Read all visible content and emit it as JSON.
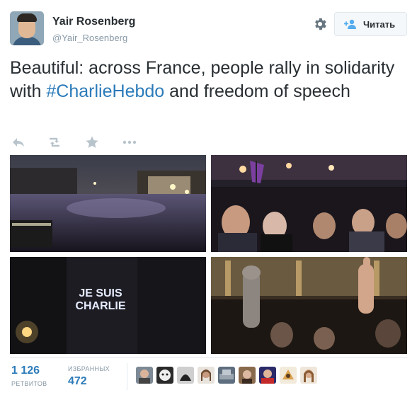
{
  "user": {
    "display_name": "Yair Rosenberg",
    "handle": "@Yair_Rosenberg"
  },
  "header": {
    "settings_icon": "gear-icon",
    "follow_label": "Читать",
    "follow_icon": "add-user-icon"
  },
  "tweet": {
    "text_before": "Beautiful: across France, people rally in solidarity with ",
    "hashtag": "#CharlieHebdo",
    "text_after": " and freedom of speech"
  },
  "actions": [
    "reply-icon",
    "retweet-icon",
    "favorite-icon",
    "more-icon"
  ],
  "photos": {
    "photo_3_sign": "JE SUIS CHARLIE"
  },
  "stats": {
    "retweets_count": "1 126",
    "retweets_label": "РЕТВИТОВ",
    "favorites_count": "472",
    "favorites_label": "ИЗБРАННЫХ"
  },
  "colors": {
    "link": "#2b7bb9",
    "text": "#292f33",
    "muted": "#8899a6",
    "border": "#e1e8ed"
  }
}
